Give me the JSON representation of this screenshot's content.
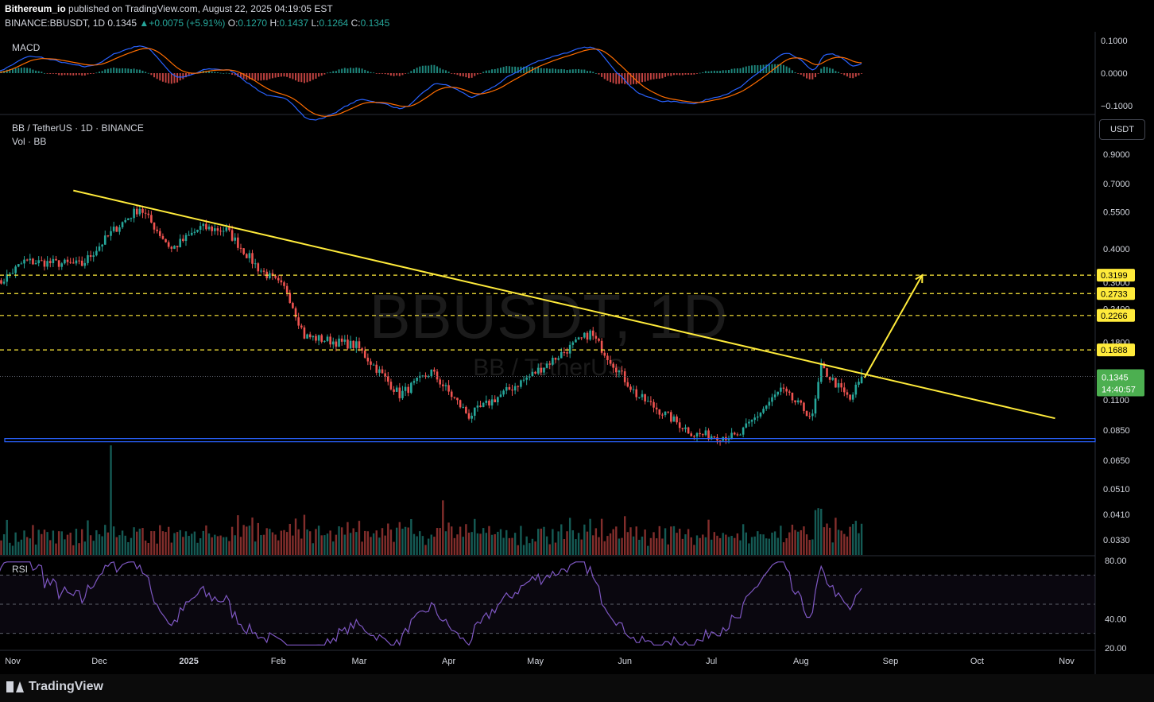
{
  "header": {
    "author": "Bithereum_io",
    "published": "published on TradingView.com, August 22, 2025 04:19:05 EST",
    "symbol": "BINANCE:BBUSDT, 1D",
    "price": "0.1345",
    "change": "+0.0075 (+5.91%)",
    "open_label": "O:",
    "open": "0.1270",
    "high_label": "H:",
    "high": "0.1437",
    "low_label": "L:",
    "low": "0.1264",
    "close_label": "C:",
    "close": "0.1345"
  },
  "panes": {
    "macd_label": "MACD",
    "main_label": "BB / TetherUS · 1D · BINANCE",
    "vol_label": "Vol · BB",
    "rsi_label": "RSI",
    "watermark": "BBUSDT, 1D",
    "watermark_sub": "BB / TetherUS",
    "currency_button": "USDT"
  },
  "colors": {
    "up": "#26a69a",
    "down": "#ef5350",
    "trendline": "#ffeb3b",
    "level": "#ffeb3b",
    "support": "#2962ff",
    "macd": "#2962ff",
    "signal": "#ff6d00",
    "rsi": "#7e57c2"
  },
  "chart_data": [
    {
      "type": "line",
      "name": "MACD",
      "y_ticks": [
        "0.1000",
        "0.0000",
        "−0.1000"
      ]
    },
    {
      "type": "candlestick",
      "name": "BB / TetherUS 1D",
      "scale": "log",
      "ylim": [
        0.075,
        1.0
      ],
      "y_ticks": [
        "0.9000",
        "0.7000",
        "0.5500",
        "0.4000",
        "0.3000",
        "0.2400",
        "0.1800",
        "0.1100",
        "0.0850",
        "0.0650",
        "0.0510",
        "0.0410",
        "0.0330"
      ],
      "x_ticks": [
        "Nov",
        "Dec",
        "2025",
        "Feb",
        "Mar",
        "Apr",
        "May",
        "Jun",
        "Jul",
        "Aug",
        "Sep",
        "Oct",
        "Nov"
      ],
      "x_tick_dates": [
        "2024-11-01",
        "2024-12-01",
        "2025-01-01",
        "2025-02-01",
        "2025-03-01",
        "2025-04-01",
        "2025-05-01",
        "2025-06-01",
        "2025-07-01",
        "2025-08-01",
        "2025-09-01",
        "2025-10-01",
        "2025-11-01"
      ],
      "levels": [
        {
          "label": "0.3199",
          "value": 0.3199
        },
        {
          "label": "0.2733",
          "value": 0.2733
        },
        {
          "label": "0.2266",
          "value": 0.2266
        },
        {
          "label": "0.1688",
          "value": 0.1688
        }
      ],
      "current_price": {
        "label": "0.1345",
        "value": 0.1345,
        "countdown": "14:40:57"
      },
      "support": 0.078,
      "trendline": [
        {
          "date": "2024-11-22",
          "value": 0.66
        },
        {
          "date": "2025-10-28",
          "value": 0.094
        }
      ],
      "projection": [
        {
          "date": "2025-08-23",
          "value": 0.133
        },
        {
          "date": "2025-09-12",
          "value": 0.32
        }
      ],
      "key_points": [
        {
          "date": "2024-10-26",
          "value": 0.29
        },
        {
          "date": "2024-11-05",
          "value": 0.36
        },
        {
          "date": "2024-11-25",
          "value": 0.35
        },
        {
          "date": "2024-12-06",
          "value": 0.47
        },
        {
          "date": "2024-12-15",
          "value": 0.57
        },
        {
          "date": "2024-12-26",
          "value": 0.4
        },
        {
          "date": "2025-01-05",
          "value": 0.48
        },
        {
          "date": "2025-01-14",
          "value": 0.47
        },
        {
          "date": "2025-01-25",
          "value": 0.34
        },
        {
          "date": "2025-02-04",
          "value": 0.28
        },
        {
          "date": "2025-02-10",
          "value": 0.19
        },
        {
          "date": "2025-02-28",
          "value": 0.175
        },
        {
          "date": "2025-03-15",
          "value": 0.115
        },
        {
          "date": "2025-03-26",
          "value": 0.14
        },
        {
          "date": "2025-04-08",
          "value": 0.096
        },
        {
          "date": "2025-04-30",
          "value": 0.137
        },
        {
          "date": "2025-05-20",
          "value": 0.195
        },
        {
          "date": "2025-06-05",
          "value": 0.115
        },
        {
          "date": "2025-06-25",
          "value": 0.082
        },
        {
          "date": "2025-07-10",
          "value": 0.08
        },
        {
          "date": "2025-07-25",
          "value": 0.12
        },
        {
          "date": "2025-08-05",
          "value": 0.095
        },
        {
          "date": "2025-08-08",
          "value": 0.145
        },
        {
          "date": "2025-08-18",
          "value": 0.11
        },
        {
          "date": "2025-08-22",
          "value": 0.1345
        }
      ]
    },
    {
      "type": "line",
      "name": "RSI",
      "ylim": [
        20,
        80
      ],
      "y_ticks": [
        "80.00",
        "40.00",
        "20.00"
      ]
    }
  ]
}
